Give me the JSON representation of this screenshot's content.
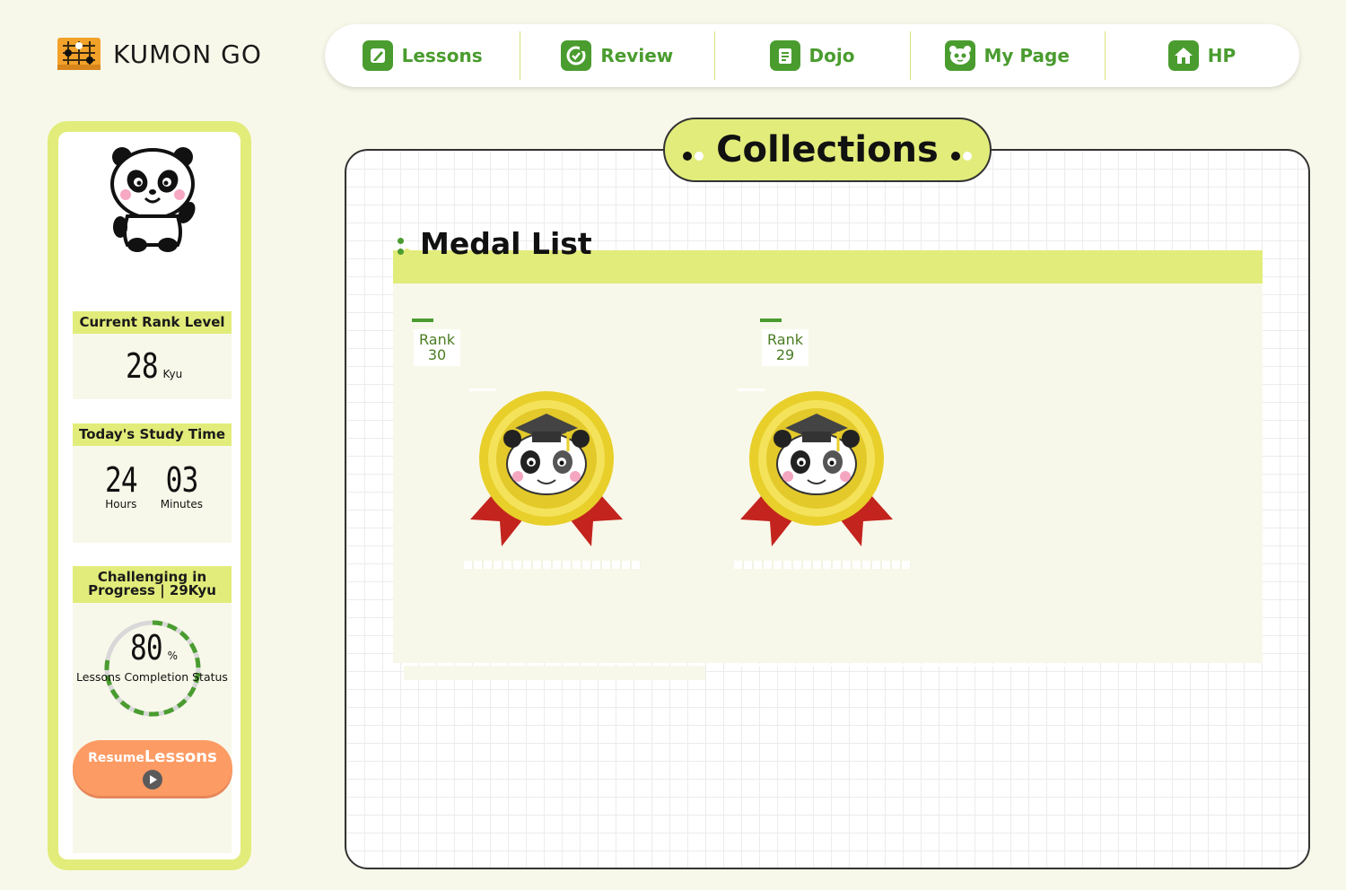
{
  "app": {
    "logo_text": "KUMON GO"
  },
  "nav": {
    "items": [
      {
        "label": "Lessons",
        "icon": "pencil-icon"
      },
      {
        "label": "Review",
        "icon": "refresh-icon"
      },
      {
        "label": "Dojo",
        "icon": "book-icon"
      },
      {
        "label": "My Page",
        "icon": "panda-face-icon"
      },
      {
        "label": "HP",
        "icon": "home-icon"
      }
    ]
  },
  "sidebar": {
    "rank": {
      "header": "Current Rank Level",
      "value": "28",
      "unit": "Kyu"
    },
    "study_time": {
      "header": "Today's Study Time",
      "hours": "24",
      "hours_label": "Hours",
      "minutes": "03",
      "minutes_label": "Minutes"
    },
    "challenge": {
      "header_line1": "Challenging in",
      "header_line2": "Progress | 29Kyu",
      "percent": "80",
      "percent_unit": "%",
      "caption": "Lessons Completion Status",
      "progress_fraction": 0.8
    },
    "resume_button": {
      "part1": "Resume",
      "part2": "Lessons"
    }
  },
  "main": {
    "title": "Collections",
    "section_title": "Medal List",
    "medals": [
      {
        "rank_label": "Rank",
        "rank_number": "30"
      },
      {
        "rank_label": "Rank",
        "rank_number": "29"
      }
    ]
  },
  "colors": {
    "background": "#f8f8ea",
    "accent_lime": "#e2ec7a",
    "nav_green": "#4a9c2f",
    "resume_orange": "#fd9b64",
    "medal_gold": "#e8cf2a",
    "ribbon_red": "#c3241d"
  }
}
